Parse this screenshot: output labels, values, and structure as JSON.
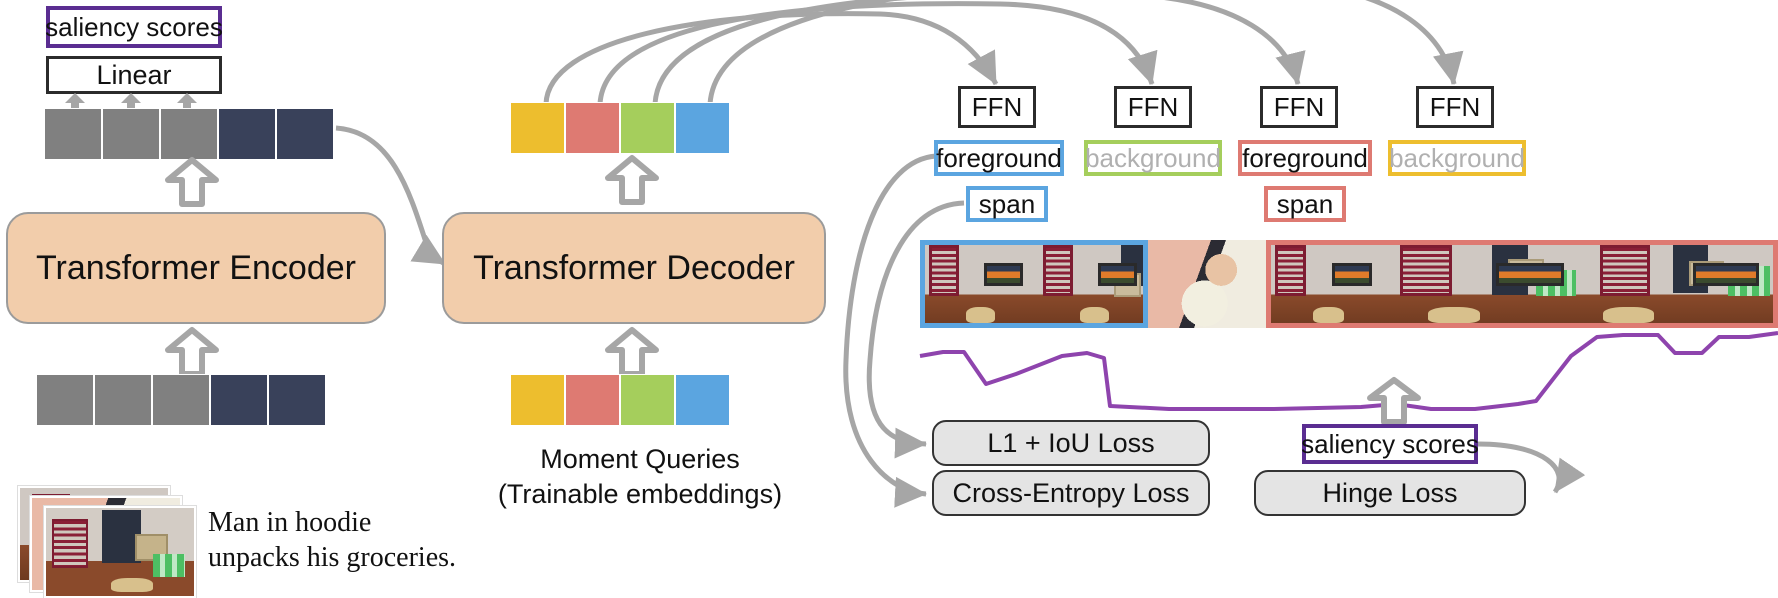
{
  "figure": {
    "title": "Moment-DETR architecture diagram",
    "colors": {
      "query_yellow": "#EDBE2E",
      "query_red": "#DE7A72",
      "query_green": "#A5CE5C",
      "query_blue": "#5BA5E0",
      "feature_gray": "#808080",
      "feature_navy": "#39415A",
      "transformer_fill": "#F2CDAB",
      "saliency_purple": "#5A2D91",
      "curve_purple": "#8E44AD",
      "loss_fill": "#E4E4E4",
      "arrow_gray": "#A6A6A6"
    }
  },
  "encoder_branch": {
    "saliency_label": "saliency scores",
    "linear_label": "Linear",
    "encoder_label": "Transformer Encoder",
    "output_tokens": [
      "gray",
      "gray",
      "gray",
      "navy",
      "navy"
    ],
    "input_tokens": [
      "gray",
      "gray",
      "gray",
      "navy",
      "navy"
    ],
    "caption_line1": "Man in hoodie",
    "caption_line2": "unpacks his groceries."
  },
  "decoder_branch": {
    "decoder_label": "Transformer Decoder",
    "output_queries": [
      "yellow",
      "red",
      "green",
      "blue"
    ],
    "input_queries": [
      "yellow",
      "red",
      "green",
      "blue"
    ],
    "queries_caption_line1": "Moment Queries",
    "queries_caption_line2": "(Trainable embeddings)"
  },
  "prediction_heads": {
    "ffn_label": "FFN",
    "ffns": [
      "FFN",
      "FFN",
      "FFN",
      "FFN"
    ],
    "classes": [
      {
        "label": "foreground",
        "color": "#5BA5E0",
        "text_color": "#111111"
      },
      {
        "label": "background",
        "color": "#A5CE5C",
        "text_color": "#B0B0B0"
      },
      {
        "label": "foreground",
        "color": "#DE7A72",
        "text_color": "#111111"
      },
      {
        "label": "background",
        "color": "#EDBE2E",
        "text_color": "#B0B0B0"
      }
    ],
    "spans": [
      {
        "label": "span",
        "color": "#5BA5E0"
      },
      {
        "label": "span",
        "color": "#DE7A72"
      }
    ]
  },
  "video_strip": {
    "segments": [
      {
        "type": "room",
        "highlight": "#5BA5E0"
      },
      {
        "type": "room",
        "highlight": "#5BA5E0"
      },
      {
        "type": "baby",
        "highlight": "none"
      },
      {
        "type": "room",
        "highlight": "#DE7A72"
      },
      {
        "type": "man",
        "highlight": "#DE7A72"
      }
    ]
  },
  "losses": {
    "l1_iou": "L1 + IoU Loss",
    "cross_entropy": "Cross-Entropy Loss",
    "hinge": "Hinge Loss",
    "saliency_label": "saliency scores"
  },
  "chart_data": {
    "type": "line",
    "title": "saliency scores",
    "xlabel": "",
    "ylabel": "",
    "series": [
      {
        "name": "saliency",
        "points": [
          [
            0.0,
            0.6
          ],
          [
            0.035,
            0.64
          ],
          [
            0.06,
            0.64
          ],
          [
            0.085,
            0.35
          ],
          [
            0.12,
            0.43
          ],
          [
            0.175,
            0.6
          ],
          [
            0.205,
            0.62
          ],
          [
            0.225,
            0.58
          ],
          [
            0.232,
            0.17
          ],
          [
            0.3,
            0.14
          ],
          [
            0.42,
            0.14
          ],
          [
            0.52,
            0.16
          ],
          [
            0.56,
            0.18
          ],
          [
            0.6,
            0.14
          ],
          [
            0.65,
            0.14
          ],
          [
            0.7,
            0.18
          ],
          [
            0.72,
            0.2
          ],
          [
            0.76,
            0.6
          ],
          [
            0.79,
            0.78
          ],
          [
            0.82,
            0.8
          ],
          [
            0.86,
            0.8
          ],
          [
            0.88,
            0.64
          ],
          [
            0.91,
            0.64
          ],
          [
            0.93,
            0.78
          ],
          [
            0.965,
            0.78
          ],
          [
            1.0,
            0.82
          ]
        ]
      }
    ],
    "xlim": [
      0,
      1
    ],
    "ylim": [
      0,
      1
    ],
    "grid": false,
    "legend": "none"
  }
}
